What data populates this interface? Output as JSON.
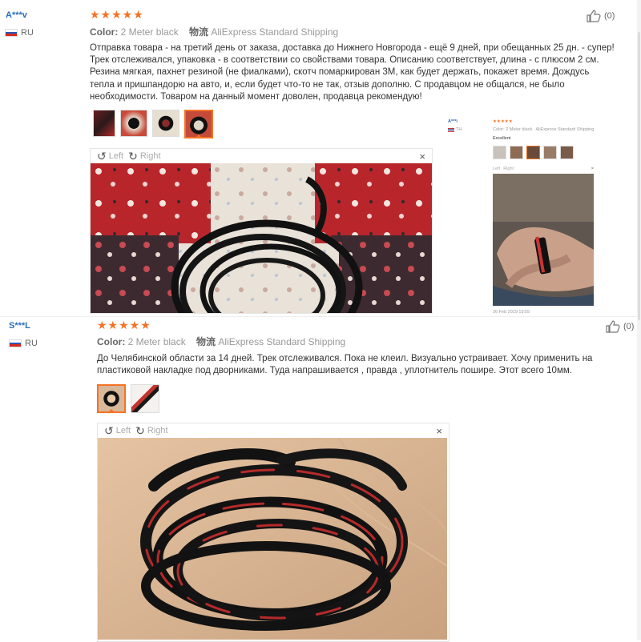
{
  "reviews": [
    {
      "user": "A***v",
      "country": "RU",
      "stars": "★★★★★",
      "color_label": "Color:",
      "color_value": "2 Meter black",
      "shipping_label": "物流",
      "shipping_value": "AliExpress Standard Shipping",
      "text": "Отправка товара - на третий день от заказа, доставка до Нижнего Новгорода - ещё 9 дней, при обещанных 25 дн. - супер! Трек отслеживался, упаковка - в соответствии со свойствами товара. Описанию соответствует, длина - с плюсом 2 см. Резина мягкая, пахнет резиной (не фиалками), скотч помаркирован 3М, как будет держать, покажет время. Дождусь тепла и пришпандорю на авто, и, если будет что-то не так, отзыв дополню. С продавцом не общался, не было необходимости. Товаром на данный момент доволен, продавца рекомендую!",
      "helpful": "(0)",
      "thumb_count": 4,
      "viewer_left": "Left",
      "viewer_right": "Right",
      "viewer_close": "×"
    },
    {
      "user": "S***L",
      "country": "RU",
      "stars": "★★★★★",
      "color_label": "Color:",
      "color_value": "2 Meter black",
      "shipping_label": "物流",
      "shipping_value": "AliExpress Standard Shipping",
      "text": "До Челябинской области за 14 дней. Трек отслеживался. Пока не клеил. Визуально устраивает. Хочу применить на пластиковой накладке под дворниками. Туда напрашивается , правда , уплотнитель пошире. Этот всего 10мм.",
      "helpful": "(0)",
      "thumb_count": 2,
      "viewer_left": "Left",
      "viewer_right": "Right",
      "viewer_close": "×"
    }
  ],
  "embedded_review": {
    "user": "A***i",
    "country": "TH",
    "stars": "★★★★★",
    "color_line": "Color: 2 Meter black",
    "shipping_line": "AliExpress Standard Shipping",
    "text": "Excellent",
    "viewer_left": "Left",
    "viewer_right": "Right",
    "date": "26 Feb 2019 19:55"
  },
  "colors": {
    "accent": "#f57224",
    "username": "#2a6ebb"
  }
}
